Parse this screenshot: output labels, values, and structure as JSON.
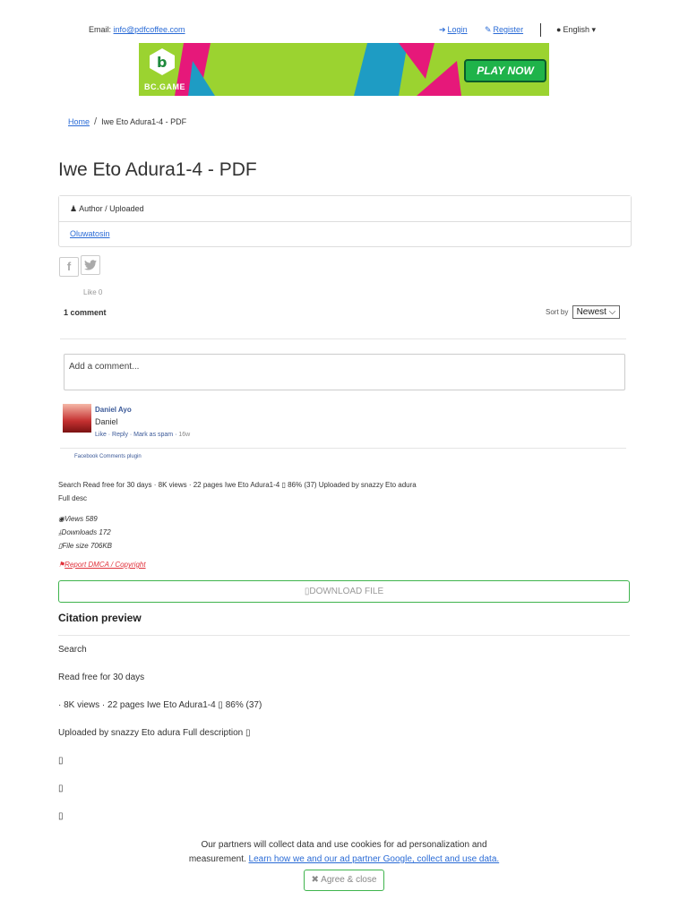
{
  "topbar": {
    "email_label": "Email:",
    "email_value": "info@pdfcoffee.com",
    "login": "Login",
    "register": "Register",
    "language": "English"
  },
  "banner": {
    "brand": "BC.GAME",
    "cta": "PLAY NOW"
  },
  "breadcrumb": {
    "home": "Home",
    "current": "Iwe Eto Adura1-4 - PDF"
  },
  "page_title": "Iwe Eto Adura1-4 - PDF",
  "author_panel": {
    "heading": "Author / Uploaded",
    "author": "Oluwatosin"
  },
  "share": {
    "facebook": "f",
    "twitter": "t",
    "like": "Like 0"
  },
  "comments": {
    "count": "1 comment",
    "sort_label": "Sort by",
    "sort_value": "Newest",
    "placeholder": "Add a comment...",
    "items": [
      {
        "name": "Daniel Ayo",
        "text": "Daniel",
        "actions": "Like · Reply · Mark as spam · ",
        "time": "16w"
      }
    ],
    "plugin": "Facebook Comments plugin"
  },
  "description": {
    "line1": "Search Read free for 30 days · 8K views · 22 pages Iwe Eto Adura1-4 ▯ 86% (37) Uploaded by snazzy Eto adura",
    "line2": "Full desc"
  },
  "stats": {
    "views": "Views 589",
    "downloads": "Downloads 172",
    "filesize": "File size 706KB"
  },
  "report": "Report DMCA / Copyright",
  "download_button": "DOWNLOAD FILE",
  "citation": {
    "title": "Citation preview",
    "lines": [
      "Search",
      "Read free for 30 days",
      "· 8K views · 22 pages Iwe Eto Adura1-4 ▯ 86% (37)",
      "Uploaded by snazzy Eto adura Full description ▯",
      "▯",
      "▯",
      "▯"
    ]
  },
  "cookie": {
    "text1": "Our partners will collect data and use cookies for ad personalization and",
    "text2": "measurement.",
    "link": "Learn how we and our ad partner Google, collect and use data.",
    "agree": "Agree & close"
  },
  "colors": {
    "link": "#2a6bd6",
    "banner_bg": "#9bd330",
    "play_button": "#1fb34a",
    "download_border": "#3fb44d",
    "report_red": "#e0303a"
  }
}
